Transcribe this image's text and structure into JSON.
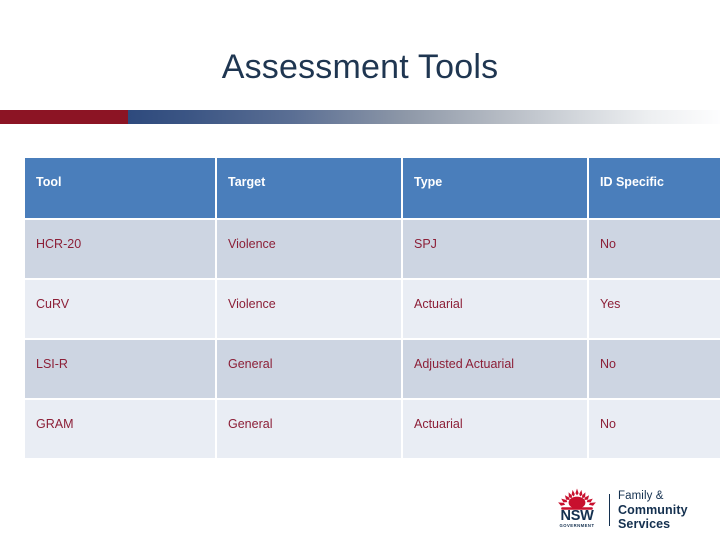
{
  "slide": {
    "title": "Assessment Tools"
  },
  "accent_bar": {
    "red_color": "#8C1424",
    "gradient_start_color": "#2E4A7D",
    "gradient_end_color": "#FFFFFF"
  },
  "table": {
    "header_bg": "#4A7EBB",
    "header_text_color": "#FFFFFF",
    "row_dark_bg": "#CDD5E2",
    "row_light_bg": "#E9EDF4",
    "cell_text_color": "#8C1F37",
    "columns": [
      "Tool",
      "Target",
      "Type",
      "ID Specific"
    ],
    "rows": [
      {
        "tool": "HCR-20",
        "target": "Violence",
        "type": "SPJ",
        "id_specific": "No"
      },
      {
        "tool": "CuRV",
        "target": "Violence",
        "type": "Actuarial",
        "id_specific": "Yes"
      },
      {
        "tool": "LSI-R",
        "target": "General",
        "type": "Adjusted Actuarial",
        "id_specific": "No"
      },
      {
        "tool": "GRAM",
        "target": "General",
        "type": "Actuarial",
        "id_specific": "No"
      }
    ]
  },
  "logo": {
    "emblem": "nsw-waratah-icon",
    "jurisdiction": "NSW",
    "jurisdiction_sub": "GOVERNMENT",
    "agency_line1": "Family &",
    "agency_line2": "Community Services",
    "brand_red": "#C8102E",
    "brand_navy": "#14304F"
  }
}
